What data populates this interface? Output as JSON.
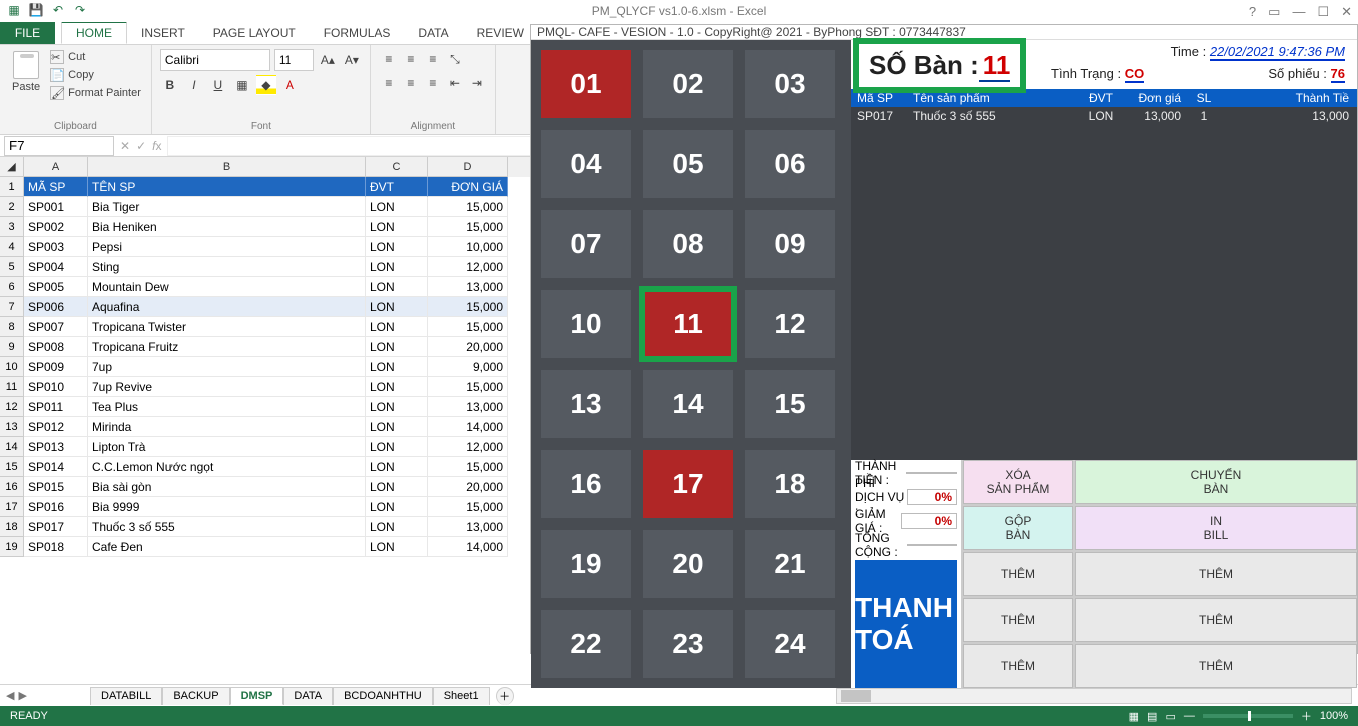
{
  "title": "PM_QLYCF vs1.0-6.xlsm - Excel",
  "tabs": {
    "file": "FILE",
    "home": "HOME",
    "insert": "INSERT",
    "pagelayout": "PAGE LAYOUT",
    "formulas": "FORMULAS",
    "data": "DATA",
    "review": "REVIEW"
  },
  "clipboard": {
    "paste": "Paste",
    "cut": "Cut",
    "copy": "Copy",
    "painter": "Format Painter",
    "label": "Clipboard"
  },
  "font": {
    "name": "Calibri",
    "size": "11",
    "label": "Font"
  },
  "alignment": {
    "label": "Alignment"
  },
  "namebox": "F7",
  "columns": [
    "A",
    "B",
    "C",
    "D"
  ],
  "headers": {
    "a": "MÃ SP",
    "b": "TÊN SP",
    "c": "ĐVT",
    "d": "ĐƠN GIÁ"
  },
  "rows": [
    {
      "n": 2,
      "a": "SP001",
      "b": "Bia Tiger",
      "c": "LON",
      "d": "15,000"
    },
    {
      "n": 3,
      "a": "SP002",
      "b": "Bia Heniken",
      "c": "LON",
      "d": "15,000"
    },
    {
      "n": 4,
      "a": "SP003",
      "b": "Pepsi",
      "c": "LON",
      "d": "10,000"
    },
    {
      "n": 5,
      "a": "SP004",
      "b": "Sting",
      "c": "LON",
      "d": "12,000"
    },
    {
      "n": 6,
      "a": "SP005",
      "b": "Mountain Dew",
      "c": "LON",
      "d": "13,000"
    },
    {
      "n": 7,
      "a": "SP006",
      "b": "Aquafina",
      "c": "LON",
      "d": "15,000",
      "sel": true
    },
    {
      "n": 8,
      "a": "SP007",
      "b": "Tropicana Twister",
      "c": "LON",
      "d": "15,000"
    },
    {
      "n": 9,
      "a": "SP008",
      "b": "Tropicana Fruitz",
      "c": "LON",
      "d": "20,000"
    },
    {
      "n": 10,
      "a": "SP009",
      "b": "7up",
      "c": "LON",
      "d": "9,000"
    },
    {
      "n": 11,
      "a": "SP010",
      "b": "7up Revive",
      "c": "LON",
      "d": "15,000"
    },
    {
      "n": 12,
      "a": "SP011",
      "b": "Tea Plus",
      "c": "LON",
      "d": "13,000"
    },
    {
      "n": 13,
      "a": "SP012",
      "b": "Mirinda",
      "c": "LON",
      "d": "14,000"
    },
    {
      "n": 14,
      "a": "SP013",
      "b": "Lipton Trà",
      "c": "LON",
      "d": "12,000"
    },
    {
      "n": 15,
      "a": "SP014",
      "b": "C.C.Lemon Nước ngọt",
      "c": "LON",
      "d": "15,000"
    },
    {
      "n": 16,
      "a": "SP015",
      "b": "Bia sài gòn",
      "c": "LON",
      "d": "20,000"
    },
    {
      "n": 17,
      "a": "SP016",
      "b": "Bia 9999",
      "c": "LON",
      "d": "15,000"
    },
    {
      "n": 18,
      "a": "SP017",
      "b": "Thuốc 3 số 555",
      "c": "LON",
      "d": "13,000"
    },
    {
      "n": 19,
      "a": "SP018",
      "b": "Cafe Đen",
      "c": "LON",
      "d": "14,000"
    }
  ],
  "sheets": [
    "DATABILL",
    "BACKUP",
    "DMSP",
    "DATA",
    "BCDOANHTHU",
    "Sheet1"
  ],
  "activeSheet": "DMSP",
  "status": {
    "ready": "READY",
    "zoom": "100%"
  },
  "pos": {
    "title": "PMQL- CAFE - VESION - 1.0 - CopyRight@ 2021 - ByPhong    SĐT : 0773447837",
    "tables": [
      {
        "n": "01",
        "occ": true
      },
      {
        "n": "02"
      },
      {
        "n": "03"
      },
      {
        "n": "04"
      },
      {
        "n": "05"
      },
      {
        "n": "06"
      },
      {
        "n": "07"
      },
      {
        "n": "08"
      },
      {
        "n": "09"
      },
      {
        "n": "10"
      },
      {
        "n": "11",
        "occ": true,
        "hl": true
      },
      {
        "n": "12"
      },
      {
        "n": "13"
      },
      {
        "n": "14"
      },
      {
        "n": "15"
      },
      {
        "n": "16"
      },
      {
        "n": "17",
        "occ": true
      },
      {
        "n": "18"
      },
      {
        "n": "19"
      },
      {
        "n": "20"
      },
      {
        "n": "21"
      },
      {
        "n": "22"
      },
      {
        "n": "23"
      },
      {
        "n": "24"
      }
    ],
    "soban_label": "SỐ Bàn :",
    "soban": "11",
    "time_label": "Time :",
    "time": "22/02/2021 9:47:36 PM",
    "tinhtrang_label": "Tình Trạng :",
    "tinhtrang": "CO",
    "sophieu_label": "Số phiếu :",
    "sophieu": "76",
    "ohdr": {
      "a": "Mã SP",
      "b": "Tên sản phẩm",
      "c": "ĐVT",
      "d": "Đơn giá",
      "e": "SL",
      "f": "Thành Tiề"
    },
    "orow": {
      "a": "SP017",
      "b": "Thuốc 3 số 555",
      "c": "LON",
      "d": "13,000",
      "e": "1",
      "f": "13,000"
    },
    "btns": {
      "xoa": "XÓA\nSẢN PHẨM",
      "chuyen": "CHUYỂN\nBÀN",
      "gop": "GỘP\nBÀN",
      "in": "IN\nBILL",
      "them": "THÊM"
    },
    "totals": {
      "thanhtien": "THÀNH TIỀN :",
      "phidv": "PHÍ DỊCH VỤ :",
      "giamgia": "GIẢM GIÁ :",
      "tongcong": "TỔNG CỘNG :",
      "pc": "0%"
    },
    "pay": "THANH TOÁ"
  }
}
